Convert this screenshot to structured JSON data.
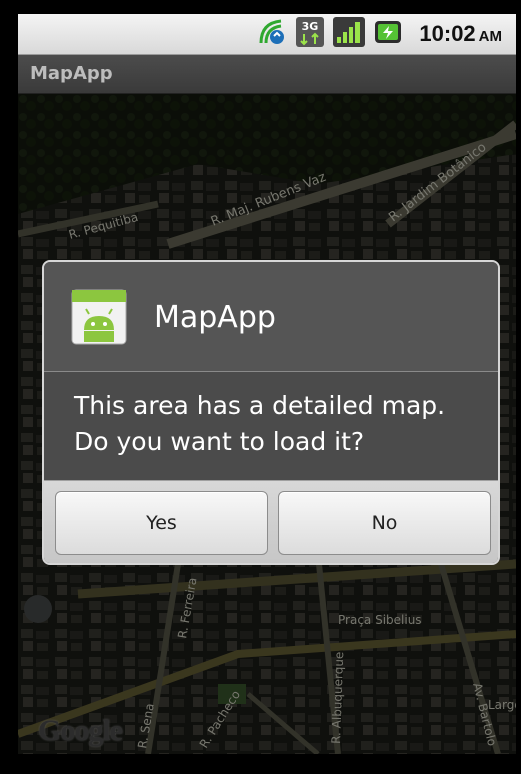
{
  "status_bar": {
    "time": "10:02",
    "ampm": "AM",
    "icons": [
      "sync-icon",
      "3g-icon",
      "signal-icon",
      "battery-icon"
    ]
  },
  "app": {
    "title": "MapApp"
  },
  "map": {
    "streets": [
      "R. Maj. Rubens Vaz",
      "R. Jardim Botânico",
      "R. Pequitiba",
      "R. Ferreira",
      "Praça Sibelius",
      "R. Albuquerque",
      "Av. Bartolo",
      "Largo Men",
      "R. Pacheco",
      "R. Sena"
    ],
    "logo": "Google"
  },
  "dialog": {
    "title": "MapApp",
    "message_line1": "This area has a detailed map.",
    "message_line2": "Do you want to load it?",
    "yes_label": "Yes",
    "no_label": "No"
  },
  "colors": {
    "dialog_bg": "#4b4b4b",
    "dialog_border": "#d6d6d6",
    "button_bar": "#cfcfcf",
    "android_green": "#8cc63f"
  }
}
